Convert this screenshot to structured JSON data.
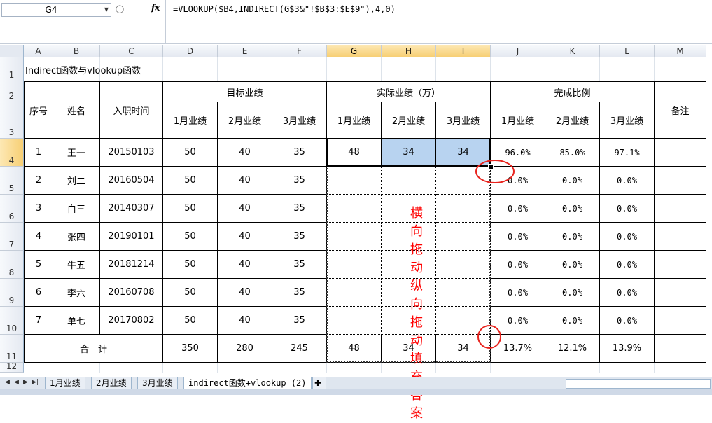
{
  "formula_bar": {
    "cell_ref": "G4",
    "fx": "fx",
    "formula": "=VLOOKUP($B4,INDIRECT(G$3&\"!$B$3:$E$9\"),4,0)"
  },
  "columns": [
    "A",
    "B",
    "C",
    "D",
    "E",
    "F",
    "G",
    "H",
    "I",
    "J",
    "K",
    "L",
    "M"
  ],
  "rows": [
    "1",
    "2",
    "3",
    "4",
    "5",
    "6",
    "7",
    "8",
    "9",
    "10",
    "11",
    "12"
  ],
  "title": "Indirect函数与vlookup函数",
  "headers": {
    "seq": "序号",
    "name": "姓名",
    "hire_date": "入职时间",
    "target": "目标业绩",
    "actual": "实际业绩（万）",
    "ratio": "完成比例",
    "note": "备注",
    "m1": "1月业绩",
    "m2": "2月业绩",
    "m3": "3月业绩"
  },
  "records": [
    {
      "seq": "1",
      "name": "王一",
      "date": "20150103",
      "t1": "50",
      "t2": "40",
      "t3": "35",
      "a1": "48",
      "a2": "34",
      "a3": "34",
      "r1": "96.0%",
      "r2": "85.0%",
      "r3": "97.1%"
    },
    {
      "seq": "2",
      "name": "刘二",
      "date": "20160504",
      "t1": "50",
      "t2": "40",
      "t3": "35",
      "a1": "",
      "a2": "",
      "a3": "",
      "r1": "0.0%",
      "r2": "0.0%",
      "r3": "0.0%"
    },
    {
      "seq": "3",
      "name": "白三",
      "date": "20140307",
      "t1": "50",
      "t2": "40",
      "t3": "35",
      "a1": "",
      "a2": "",
      "a3": "",
      "r1": "0.0%",
      "r2": "0.0%",
      "r3": "0.0%"
    },
    {
      "seq": "4",
      "name": "张四",
      "date": "20190101",
      "t1": "50",
      "t2": "40",
      "t3": "35",
      "a1": "",
      "a2": "",
      "a3": "",
      "r1": "0.0%",
      "r2": "0.0%",
      "r3": "0.0%"
    },
    {
      "seq": "5",
      "name": "牛五",
      "date": "20181214",
      "t1": "50",
      "t2": "40",
      "t3": "35",
      "a1": "",
      "a2": "",
      "a3": "",
      "r1": "0.0%",
      "r2": "0.0%",
      "r3": "0.0%"
    },
    {
      "seq": "6",
      "name": "李六",
      "date": "20160708",
      "t1": "50",
      "t2": "40",
      "t3": "35",
      "a1": "",
      "a2": "",
      "a3": "",
      "r1": "0.0%",
      "r2": "0.0%",
      "r3": "0.0%"
    },
    {
      "seq": "7",
      "name": "单七",
      "date": "20170802",
      "t1": "50",
      "t2": "40",
      "t3": "35",
      "a1": "",
      "a2": "",
      "a3": "",
      "r1": "0.0%",
      "r2": "0.0%",
      "r3": "0.0%"
    }
  ],
  "total": {
    "label": "合　计",
    "t1": "350",
    "t2": "280",
    "t3": "245",
    "a1": "48",
    "a2": "34",
    "a3": "34",
    "r1": "13.7%",
    "r2": "12.1%",
    "r3": "13.9%"
  },
  "annotation": {
    "line1": "横向拖动",
    "line2": "纵向拖动",
    "line3": "填充答案",
    "color": "#ff0000"
  },
  "tabs": [
    "1月业绩",
    "2月业绩",
    "3月业绩",
    "indirect函数+vlookup (2)"
  ],
  "active_tab": 3,
  "colors": {
    "selection": "#b8d3f0",
    "header_selected": "#f7cf74",
    "circle": "#e8231d"
  }
}
